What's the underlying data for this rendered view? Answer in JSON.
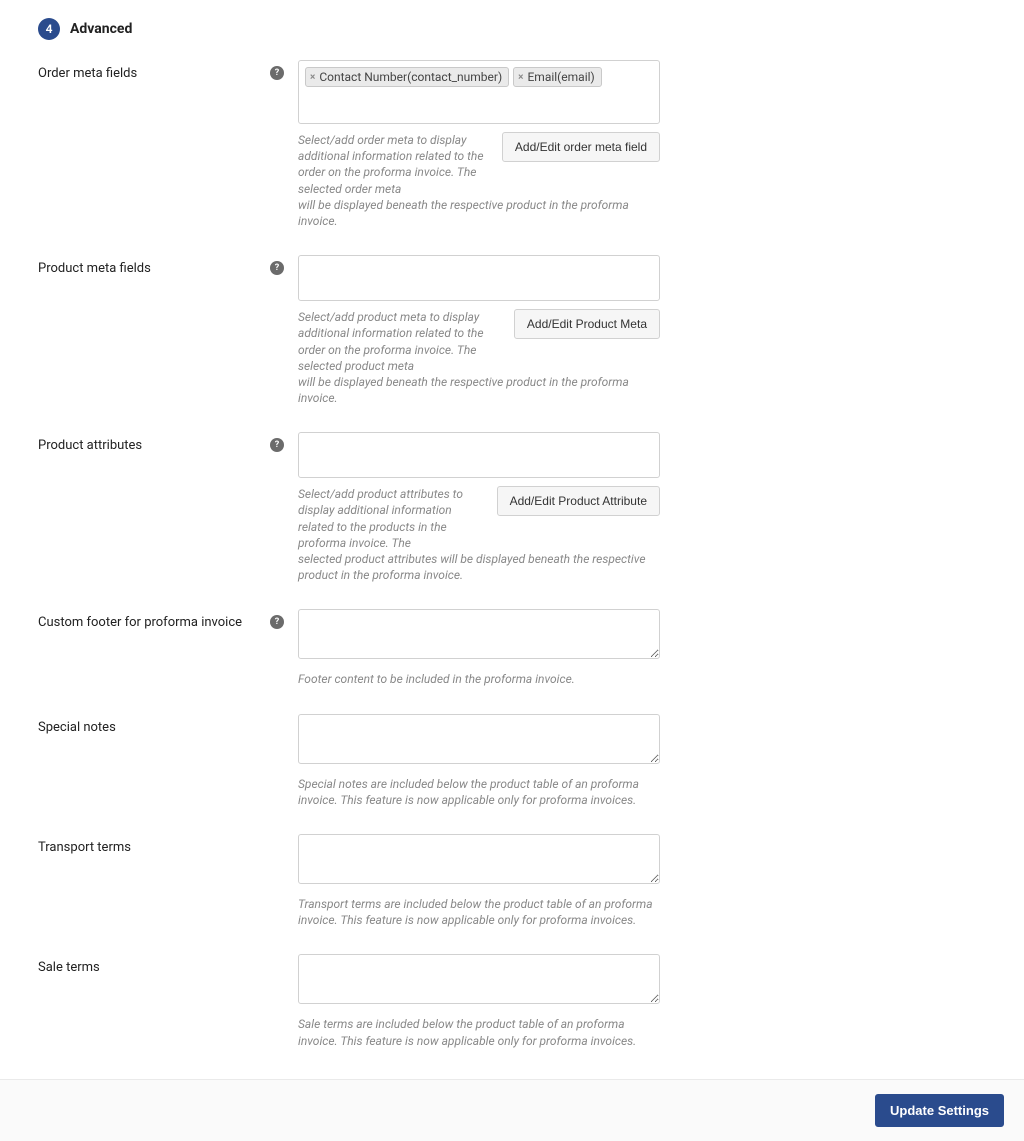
{
  "section": {
    "number": "4",
    "title": "Advanced"
  },
  "fields": {
    "orderMeta": {
      "label": "Order meta fields",
      "tags": [
        "Contact Number(contact_number)",
        "Email(email)"
      ],
      "description": "Select/add order meta to display additional information related to the order on the proforma invoice. The selected order meta will be displayed beneath the respective product in the proforma invoice.",
      "buttonLabel": "Add/Edit order meta field"
    },
    "productMeta": {
      "label": "Product meta fields",
      "description": "Select/add product meta to display additional information related to the order on the proforma invoice. The selected product meta will be displayed beneath the respective product in the proforma invoice.",
      "buttonLabel": "Add/Edit Product Meta"
    },
    "productAttributes": {
      "label": "Product attributes",
      "description": "Select/add product attributes to display additional information related to the products in the proforma invoice. The selected product attributes will be displayed beneath the respective product in the proforma invoice.",
      "buttonLabel": "Add/Edit Product Attribute"
    },
    "customFooter": {
      "label": "Custom footer for proforma invoice",
      "description": "Footer content to be included in the proforma invoice."
    },
    "specialNotes": {
      "label": "Special notes",
      "description": "Special notes are included below the product table of an proforma invoice. This feature is now applicable only for proforma invoices."
    },
    "transportTerms": {
      "label": "Transport terms",
      "description": "Transport terms are included below the product table of an proforma invoice. This feature is now applicable only for proforma invoices."
    },
    "saleTerms": {
      "label": "Sale terms",
      "description": "Sale terms are included below the product table of an proforma invoice. This feature is now applicable only for proforma invoices."
    }
  },
  "footer": {
    "updateButton": "Update Settings"
  }
}
